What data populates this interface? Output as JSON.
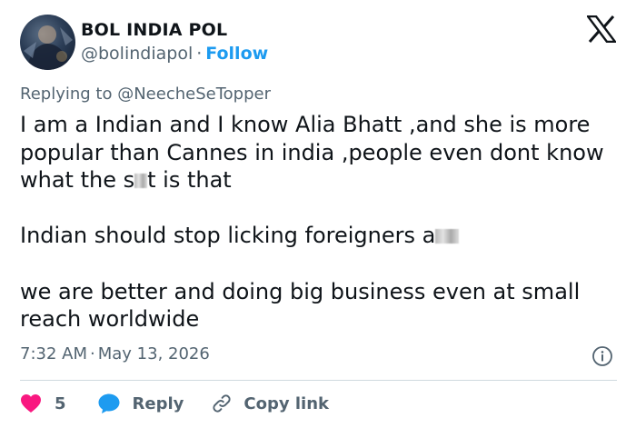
{
  "author": {
    "display_name": "BOL INDIA POL",
    "handle": "@bolindiapol",
    "separator": "·",
    "follow_label": "Follow"
  },
  "reply_context": {
    "prefix": "Replying to",
    "mention": "@NeecheSeTopper"
  },
  "tweet": {
    "p1_a": "I am a Indian and I know Alia Bhatt ,and she is more popular than Cannes in india ,people even dont know what the s",
    "p1_b": "t is that",
    "p2": "Indian should stop licking foreigners a",
    "p3": "we are better and doing big business even at small reach worldwide"
  },
  "meta": {
    "time": "7:32 AM",
    "separator": "·",
    "date": "May 13, 2026"
  },
  "actions": {
    "like_count": "5",
    "reply_label": "Reply",
    "copy_label": "Copy link"
  },
  "icons": {
    "brand": "x-logo-icon",
    "info": "info-icon",
    "like": "heart-icon",
    "reply": "speech-bubble-icon",
    "copy": "link-icon"
  },
  "colors": {
    "accent": "#1d9bf0",
    "like": "#f91880",
    "secondary_text": "#536471",
    "primary_text": "#0f1419",
    "divider": "#cfd9de"
  }
}
